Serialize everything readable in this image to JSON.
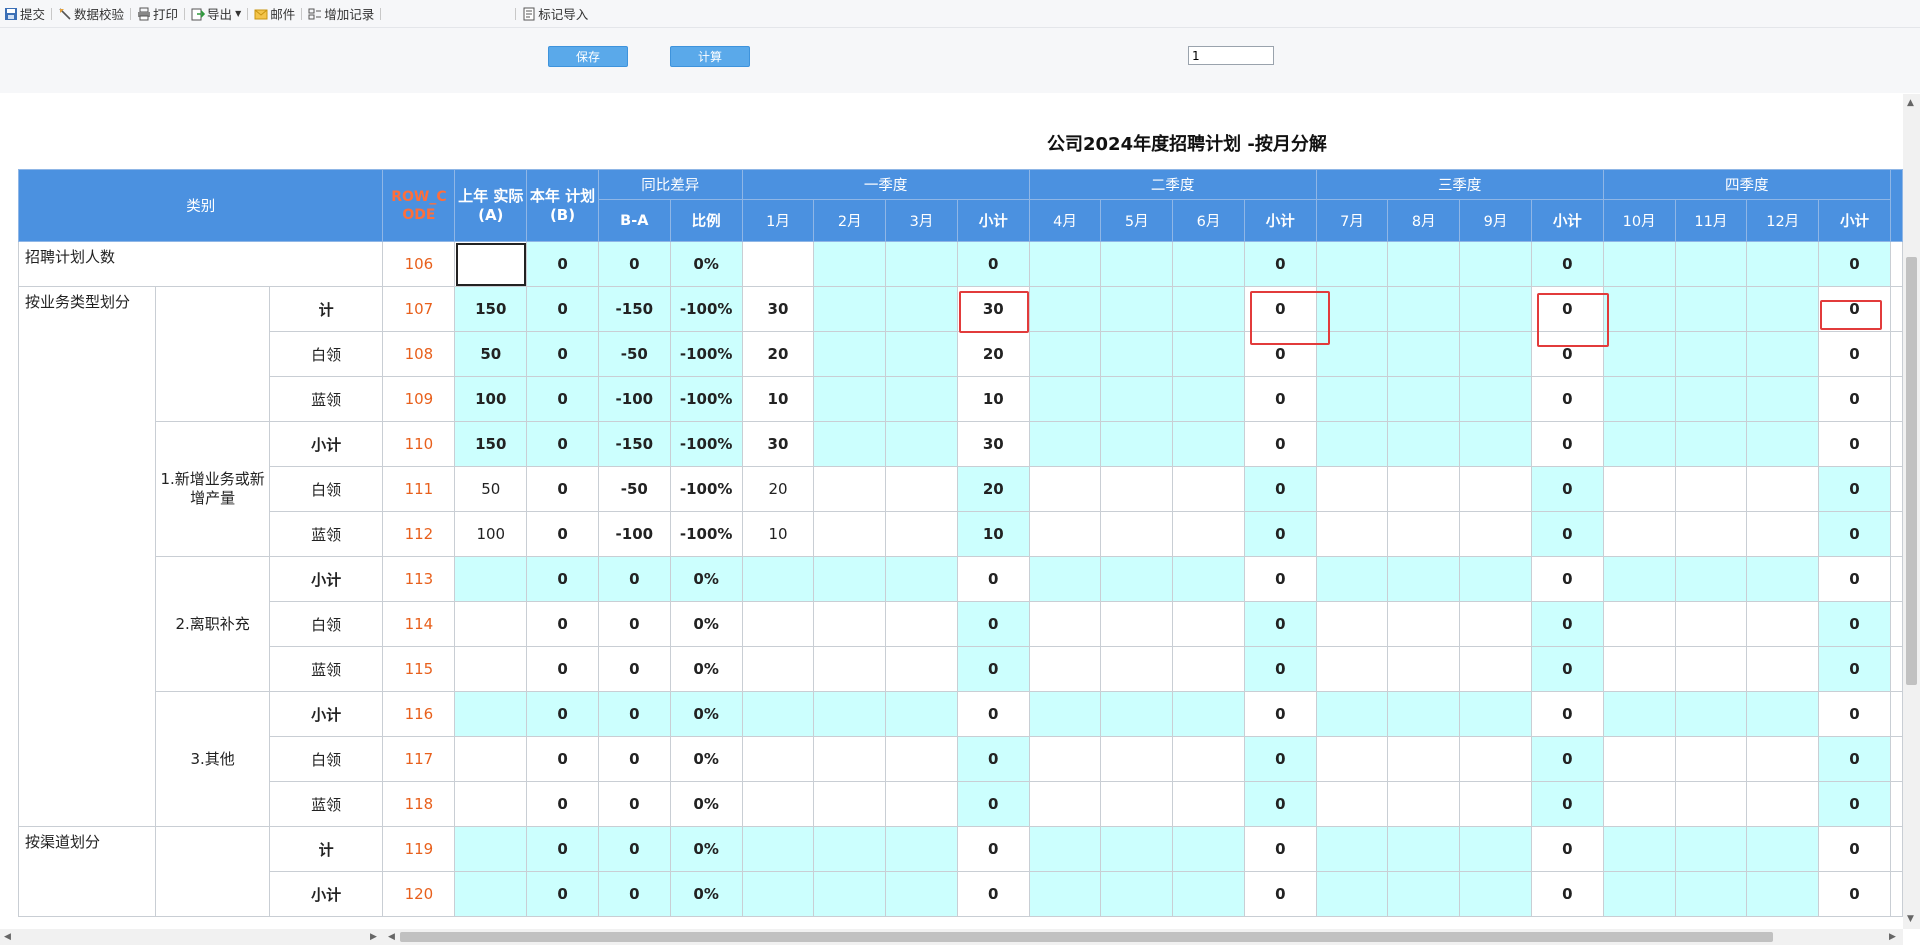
{
  "toolbar": {
    "items": [
      {
        "label": "提交",
        "icon": "submit-icon"
      },
      {
        "label": "数据校验",
        "icon": "validate-icon"
      },
      {
        "label": "打印",
        "icon": "print-icon"
      },
      {
        "label": "导出",
        "icon": "export-icon"
      },
      {
        "label": "邮件",
        "icon": "mail-icon"
      },
      {
        "label": "增加记录",
        "icon": "add-record-icon"
      },
      {
        "label": "标记导入",
        "icon": "mark-import-icon"
      }
    ]
  },
  "actions": {
    "save_label": "保存",
    "calc_label": "计算",
    "page_value": "1"
  },
  "report": {
    "title": "公司2024年度招聘计划 -按月分解",
    "headers": {
      "category": "类别",
      "row_code": "ROW_C ODE",
      "prev_actual": "上年 实际 (A)",
      "this_plan": "本年 计划 (B)",
      "yoy": "同比差异",
      "b_minus_a": "B-A",
      "ratio": "比例",
      "q1": "一季度",
      "q2": "二季度",
      "q3": "三季度",
      "q4": "四季度",
      "months": [
        "1月",
        "2月",
        "3月",
        "4月",
        "5月",
        "6月",
        "7月",
        "8月",
        "9月",
        "10月",
        "11月",
        "12月"
      ],
      "subtotal": "小计"
    },
    "groups": {
      "g1": "招聘计划人数",
      "g2": "按业务类型划分",
      "g3": "按渠道划分",
      "sub1": "1.新增业务或新增产量",
      "sub2": "2.离职补充",
      "sub3": "3.其他"
    },
    "rows": [
      {
        "label": "",
        "code": "106",
        "a": "",
        "b": "0",
        "ba": "0",
        "ratio": "0%",
        "m1": "",
        "m2": "",
        "m3": "",
        "q1": "0",
        "m4": "",
        "m5": "",
        "m6": "",
        "q2": "0",
        "m7": "",
        "m8": "",
        "m9": "",
        "q3": "0",
        "m10": "",
        "m11": "",
        "m12": "",
        "q4": "0"
      },
      {
        "label": "计",
        "code": "107",
        "a": "150",
        "b": "0",
        "ba": "-150",
        "ratio": "-100%",
        "m1": "30",
        "m2": "",
        "m3": "",
        "q1": "30",
        "m4": "",
        "m5": "",
        "m6": "",
        "q2": "0",
        "m7": "",
        "m8": "",
        "m9": "",
        "q3": "0",
        "m10": "",
        "m11": "",
        "m12": "",
        "q4": "0"
      },
      {
        "label": "白领",
        "code": "108",
        "a": "50",
        "b": "0",
        "ba": "-50",
        "ratio": "-100%",
        "m1": "20",
        "m2": "",
        "m3": "",
        "q1": "20",
        "m4": "",
        "m5": "",
        "m6": "",
        "q2": "0",
        "m7": "",
        "m8": "",
        "m9": "",
        "q3": "0",
        "m10": "",
        "m11": "",
        "m12": "",
        "q4": "0"
      },
      {
        "label": "蓝领",
        "code": "109",
        "a": "100",
        "b": "0",
        "ba": "-100",
        "ratio": "-100%",
        "m1": "10",
        "m2": "",
        "m3": "",
        "q1": "10",
        "m4": "",
        "m5": "",
        "m6": "",
        "q2": "0",
        "m7": "",
        "m8": "",
        "m9": "",
        "q3": "0",
        "m10": "",
        "m11": "",
        "m12": "",
        "q4": "0"
      },
      {
        "label": "小计",
        "code": "110",
        "a": "150",
        "b": "0",
        "ba": "-150",
        "ratio": "-100%",
        "m1": "30",
        "m2": "",
        "m3": "",
        "q1": "30",
        "m4": "",
        "m5": "",
        "m6": "",
        "q2": "0",
        "m7": "",
        "m8": "",
        "m9": "",
        "q3": "0",
        "m10": "",
        "m11": "",
        "m12": "",
        "q4": "0"
      },
      {
        "label": "白领",
        "code": "111",
        "a": "50",
        "b": "0",
        "ba": "-50",
        "ratio": "-100%",
        "m1": "20",
        "m2": "",
        "m3": "",
        "q1": "20",
        "m4": "",
        "m5": "",
        "m6": "",
        "q2": "0",
        "m7": "",
        "m8": "",
        "m9": "",
        "q3": "0",
        "m10": "",
        "m11": "",
        "m12": "",
        "q4": "0"
      },
      {
        "label": "蓝领",
        "code": "112",
        "a": "100",
        "b": "0",
        "ba": "-100",
        "ratio": "-100%",
        "m1": "10",
        "m2": "",
        "m3": "",
        "q1": "10",
        "m4": "",
        "m5": "",
        "m6": "",
        "q2": "0",
        "m7": "",
        "m8": "",
        "m9": "",
        "q3": "0",
        "m10": "",
        "m11": "",
        "m12": "",
        "q4": "0"
      },
      {
        "label": "小计",
        "code": "113",
        "a": "",
        "b": "0",
        "ba": "0",
        "ratio": "0%",
        "m1": "",
        "m2": "",
        "m3": "",
        "q1": "0",
        "m4": "",
        "m5": "",
        "m6": "",
        "q2": "0",
        "m7": "",
        "m8": "",
        "m9": "",
        "q3": "0",
        "m10": "",
        "m11": "",
        "m12": "",
        "q4": "0"
      },
      {
        "label": "白领",
        "code": "114",
        "a": "",
        "b": "0",
        "ba": "0",
        "ratio": "0%",
        "m1": "",
        "m2": "",
        "m3": "",
        "q1": "0",
        "m4": "",
        "m5": "",
        "m6": "",
        "q2": "0",
        "m7": "",
        "m8": "",
        "m9": "",
        "q3": "0",
        "m10": "",
        "m11": "",
        "m12": "",
        "q4": "0"
      },
      {
        "label": "蓝领",
        "code": "115",
        "a": "",
        "b": "0",
        "ba": "0",
        "ratio": "0%",
        "m1": "",
        "m2": "",
        "m3": "",
        "q1": "0",
        "m4": "",
        "m5": "",
        "m6": "",
        "q2": "0",
        "m7": "",
        "m8": "",
        "m9": "",
        "q3": "0",
        "m10": "",
        "m11": "",
        "m12": "",
        "q4": "0"
      },
      {
        "label": "小计",
        "code": "116",
        "a": "",
        "b": "0",
        "ba": "0",
        "ratio": "0%",
        "m1": "",
        "m2": "",
        "m3": "",
        "q1": "0",
        "m4": "",
        "m5": "",
        "m6": "",
        "q2": "0",
        "m7": "",
        "m8": "",
        "m9": "",
        "q3": "0",
        "m10": "",
        "m11": "",
        "m12": "",
        "q4": "0"
      },
      {
        "label": "白领",
        "code": "117",
        "a": "",
        "b": "0",
        "ba": "0",
        "ratio": "0%",
        "m1": "",
        "m2": "",
        "m3": "",
        "q1": "0",
        "m4": "",
        "m5": "",
        "m6": "",
        "q2": "0",
        "m7": "",
        "m8": "",
        "m9": "",
        "q3": "0",
        "m10": "",
        "m11": "",
        "m12": "",
        "q4": "0"
      },
      {
        "label": "蓝领",
        "code": "118",
        "a": "",
        "b": "0",
        "ba": "0",
        "ratio": "0%",
        "m1": "",
        "m2": "",
        "m3": "",
        "q1": "0",
        "m4": "",
        "m5": "",
        "m6": "",
        "q2": "0",
        "m7": "",
        "m8": "",
        "m9": "",
        "q3": "0",
        "m10": "",
        "m11": "",
        "m12": "",
        "q4": "0"
      },
      {
        "label": "计",
        "code": "119",
        "a": "",
        "b": "0",
        "ba": "0",
        "ratio": "0%",
        "m1": "",
        "m2": "",
        "m3": "",
        "q1": "0",
        "m4": "",
        "m5": "",
        "m6": "",
        "q2": "0",
        "m7": "",
        "m8": "",
        "m9": "",
        "q3": "0",
        "m10": "",
        "m11": "",
        "m12": "",
        "q4": "0"
      },
      {
        "label": "小计",
        "code": "120",
        "a": "",
        "b": "0",
        "ba": "0",
        "ratio": "0%",
        "m1": "",
        "m2": "",
        "m3": "",
        "q1": "0",
        "m4": "",
        "m5": "",
        "m6": "",
        "q2": "0",
        "m7": "",
        "m8": "",
        "m9": "",
        "q3": "0",
        "m10": "",
        "m11": "",
        "m12": "",
        "q4": "0"
      }
    ]
  }
}
